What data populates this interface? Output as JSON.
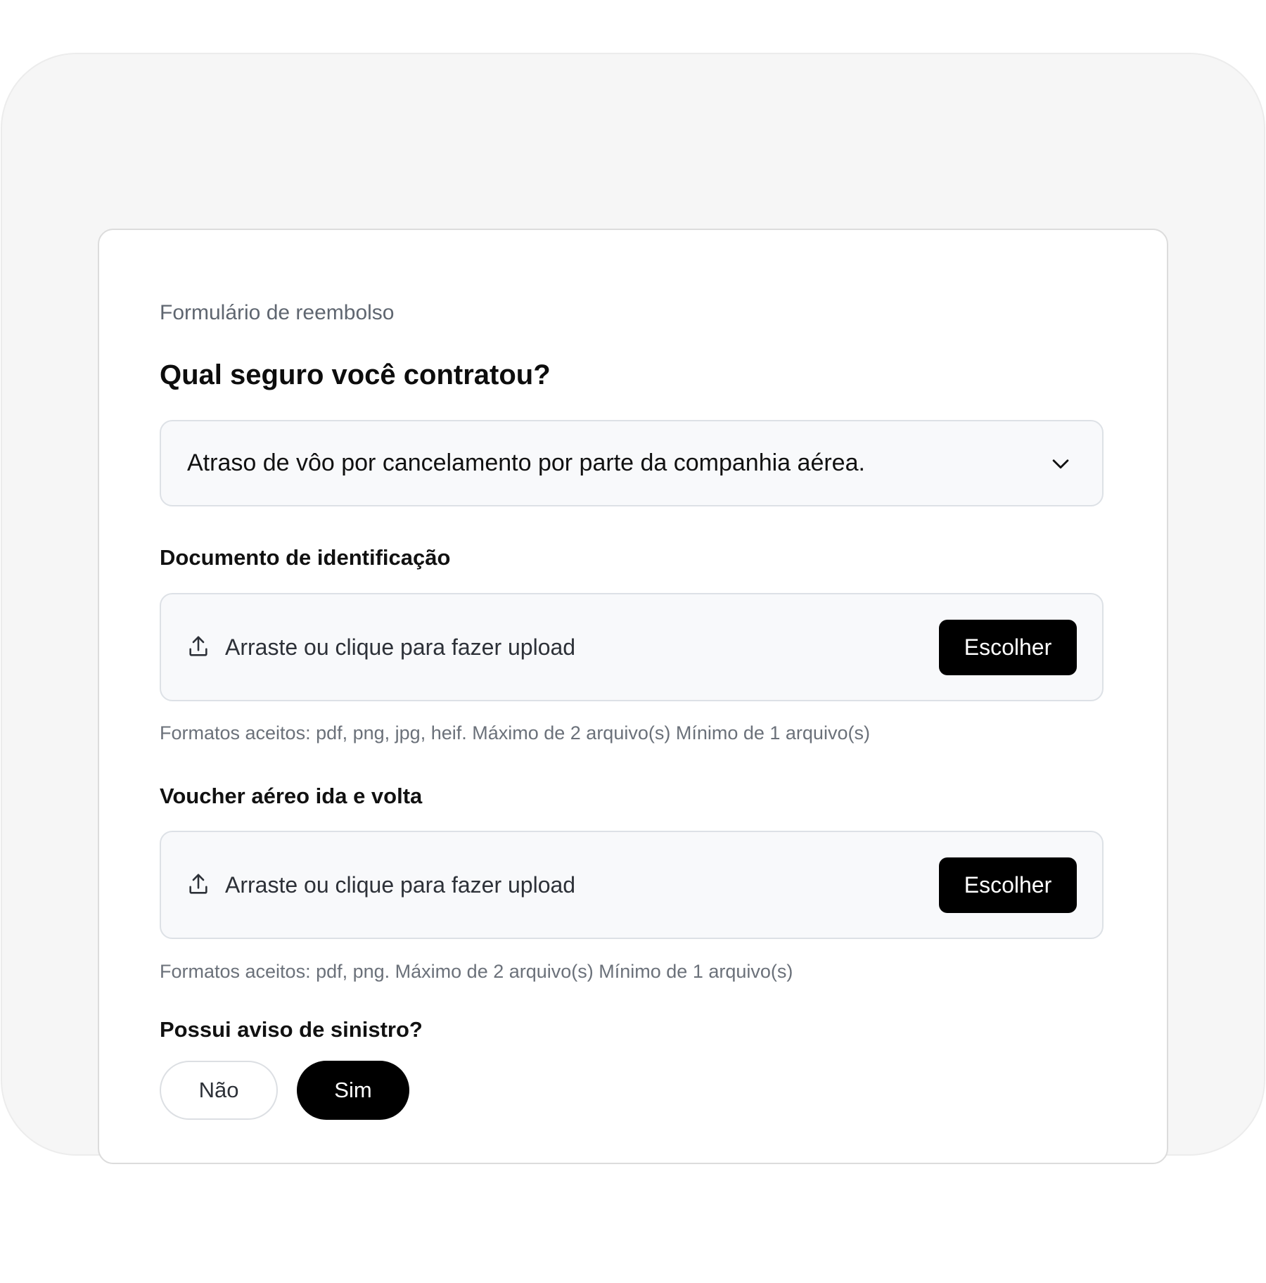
{
  "form": {
    "eyebrow": "Formulário de reembolso",
    "question_title": "Qual seguro você contratou?",
    "insurance_select": {
      "value": "Atraso de vôo por cancelamento por parte da companhia aérea.",
      "icon": "chevron-down-icon"
    },
    "id_document": {
      "label": "Documento de identificação",
      "upload_text": "Arraste ou clique para fazer upload",
      "upload_icon": "upload-icon",
      "button_label": "Escolher",
      "help_text": "Formatos aceitos: pdf, png, jpg, heif.  Máximo de 2 arquivo(s) Mínimo de 1 arquivo(s)"
    },
    "flight_voucher": {
      "label": "Voucher aéreo ida e volta",
      "upload_text": "Arraste ou clique para fazer upload",
      "upload_icon": "upload-icon",
      "button_label": "Escolher",
      "help_text": "Formatos aceitos: pdf, png. Máximo de 2 arquivo(s) Mínimo de 1 arquivo(s)"
    },
    "claim_notice": {
      "label": "Possui aviso de sinistro?",
      "options": [
        "Não",
        "Sim"
      ],
      "selected": "Sim"
    }
  },
  "colors": {
    "page_background": "#ffffff",
    "outer_panel": "#f6f6f6",
    "card": "#ffffff",
    "field_background": "#f8f9fb",
    "primary_button": "#000000",
    "primary_button_text": "#ffffff",
    "muted_text": "#6b717a"
  }
}
